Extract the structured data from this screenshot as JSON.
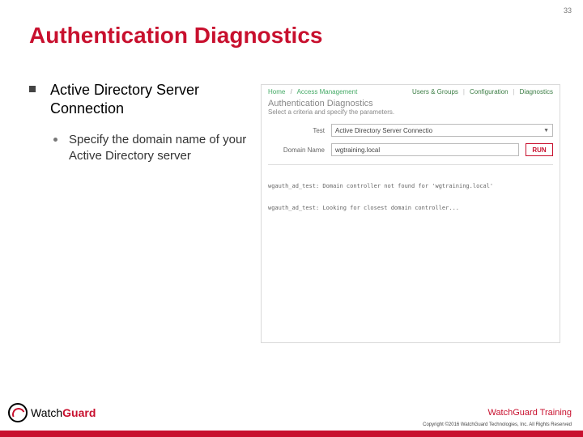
{
  "page_number": "33",
  "title": "Authentication Diagnostics",
  "bullets": {
    "l1": "Active Directory Server Connection",
    "l2": "Specify the domain name of your Active Directory server"
  },
  "panel": {
    "breadcrumb_home": "Home",
    "breadcrumb_section": "Access Management",
    "tab_users": "Users & Groups",
    "tab_config": "Configuration",
    "tab_diag": "Diagnostics",
    "heading": "Authentication Diagnostics",
    "subheading": "Select a criteria and specify the parameters.",
    "label_test": "Test",
    "test_value": "Active Directory Server Connectio",
    "label_domain": "Domain Name",
    "domain_value": "wgtraining.local",
    "run_label": "RUN",
    "output_line1": "wgauth_ad_test: Domain controller not found for 'wgtraining.local'",
    "output_line2": "wgauth_ad_test: Looking for closest domain controller..."
  },
  "footer": {
    "brand_left": "Watch",
    "brand_right": "Guard",
    "training": "WatchGuard Training",
    "copyright": "Copyright ©2016 WatchGuard Technologies, Inc. All Rights Reserved"
  }
}
